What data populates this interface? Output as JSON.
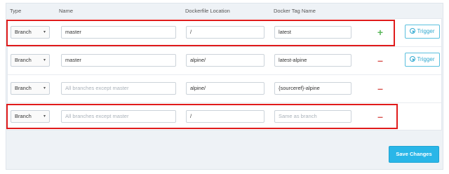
{
  "headers": {
    "type": "Type",
    "name": "Name",
    "location": "Dockerfile Location",
    "tag": "Docker Tag Name"
  },
  "rows": [
    {
      "type": "Branch",
      "name": {
        "value": "master",
        "placeholder": ""
      },
      "location": {
        "value": "/",
        "placeholder": ""
      },
      "tag": {
        "value": "latest",
        "placeholder": ""
      },
      "action": "+",
      "trigger": "Trigger"
    },
    {
      "type": "Branch",
      "name": {
        "value": "master",
        "placeholder": ""
      },
      "location": {
        "value": "alpine/",
        "placeholder": ""
      },
      "tag": {
        "value": "latest-alpine",
        "placeholder": ""
      },
      "action": "–",
      "trigger": "Trigger"
    },
    {
      "type": "Branch",
      "name": {
        "value": "",
        "placeholder": "All branches except master"
      },
      "location": {
        "value": "alpine/",
        "placeholder": ""
      },
      "tag": {
        "value": "{sourceref}-alpine",
        "placeholder": ""
      },
      "action": "–"
    },
    {
      "type": "Branch",
      "name": {
        "value": "",
        "placeholder": "All branches except master"
      },
      "location": {
        "value": "/",
        "placeholder": ""
      },
      "tag": {
        "value": "",
        "placeholder": "Same as branch"
      },
      "action": "–"
    }
  ],
  "save_button": "Save Changes",
  "colors": {
    "highlight": "#e01b1b",
    "plus": "#5cb85c",
    "minus": "#d9534f",
    "accent": "#29b6e8"
  },
  "icons": {
    "trigger": "play-circle-icon",
    "select": "caret-down-icon"
  }
}
